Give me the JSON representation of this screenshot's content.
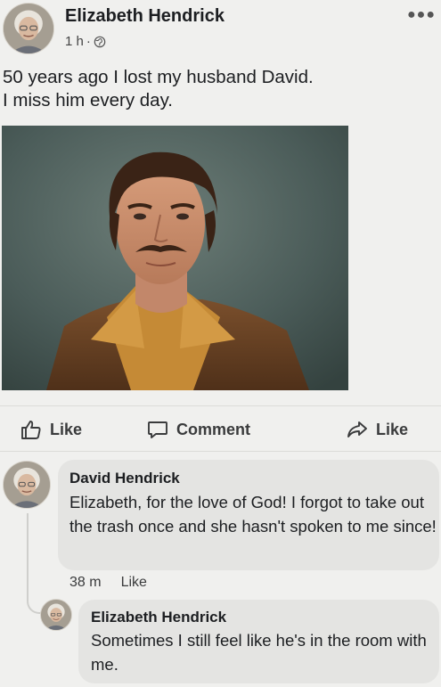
{
  "post": {
    "author": "Elizabeth Hendrick",
    "time": "1 h",
    "separator": "·",
    "text": "50 years ago I lost my husband David.\nI miss him every day.",
    "more_icon": "more-options-icon",
    "privacy_icon": "globe-icon"
  },
  "actions": {
    "like_label": "Like",
    "comment_label": "Comment",
    "share_label": "Like"
  },
  "comments": [
    {
      "author": "David Hendrick",
      "text": "Elizabeth, for the love of God! I forgot to take out the trash once and she hasn't spoken to me since!",
      "time": "38 m",
      "like_label": "Like"
    }
  ],
  "reply": {
    "author": "Elizabeth Hendrick",
    "text": "Sometimes I still feel like he's in the room with me."
  },
  "colors": {
    "background": "#f0f0ee",
    "bubble": "#e4e4e2",
    "text": "#1c1e21",
    "secondary": "#3a3b3c"
  }
}
